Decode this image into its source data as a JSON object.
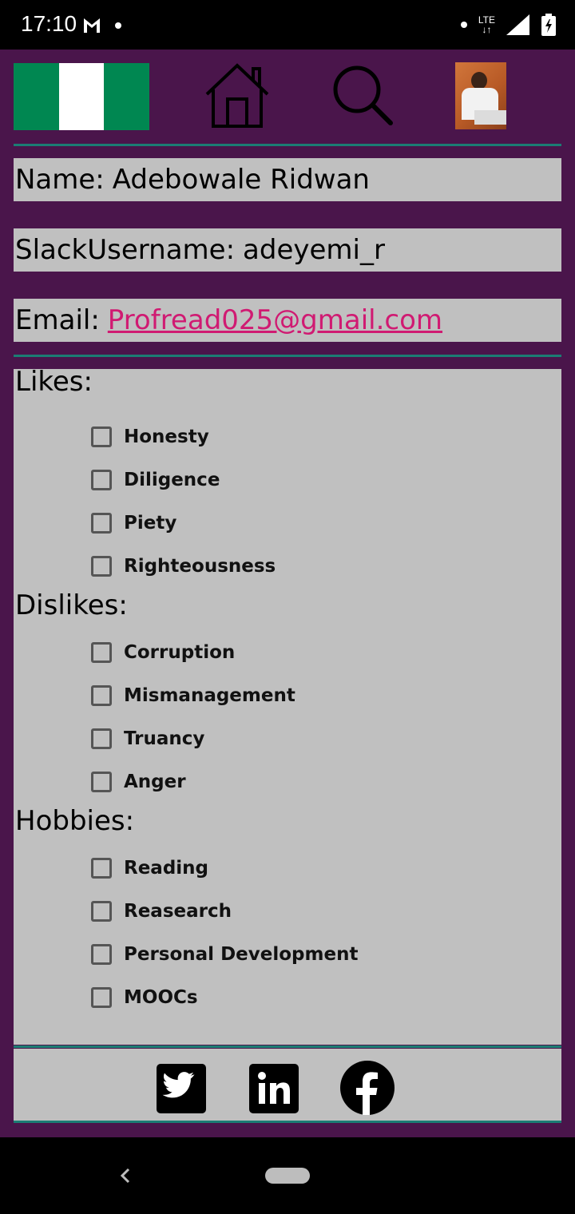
{
  "status_bar": {
    "time": "17:10",
    "network": "LTE"
  },
  "header": {
    "flag_colors": [
      "#008751",
      "#ffffff",
      "#008751"
    ],
    "home_icon": "home-icon",
    "search_icon": "search-icon"
  },
  "profile": {
    "name_label": "Name:",
    "name_value": "Adebowale Ridwan",
    "slack_label": "SlackUsername:",
    "slack_value": "adeyemi_r",
    "email_label": "Email:",
    "email_value": "Profread025@gmail.com"
  },
  "likes": {
    "title": "Likes:",
    "items": [
      "Honesty",
      "Diligence",
      "Piety",
      "Righteousness"
    ]
  },
  "dislikes": {
    "title": "Dislikes:",
    "items": [
      "Corruption",
      "Mismanagement",
      "Truancy",
      "Anger"
    ]
  },
  "hobbies": {
    "title": "Hobbies:",
    "items": [
      "Reading",
      "Reasearch",
      "Personal Development",
      "MOOCs"
    ]
  },
  "social": [
    "twitter-icon",
    "linkedin-icon",
    "facebook-icon"
  ],
  "colors": {
    "app_background": "#4a154b",
    "panel": "#c0c0c0",
    "divider": "#1b7d74",
    "link": "#d01a72"
  }
}
